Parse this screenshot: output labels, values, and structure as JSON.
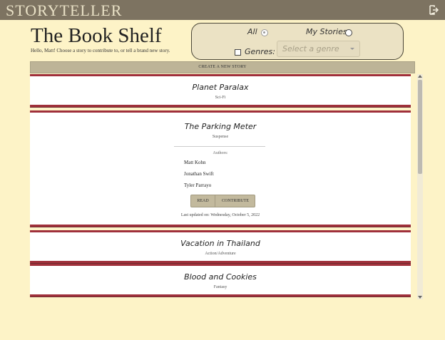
{
  "header": {
    "brand": "STORYTELLER",
    "logout_icon": "logout-icon"
  },
  "page": {
    "title": "The Book Shelf",
    "subtitle": "Hello, Matt! Choose a story to contribute to, or tell a brand new story."
  },
  "filters": {
    "all_label": "All",
    "all_selected": true,
    "my_stories_label": "My Stories",
    "my_stories_selected": false,
    "genres_label": "Genres:",
    "genres_checked": false,
    "genre_placeholder": "Select a genre"
  },
  "create_label": "CREATE A NEW STORY",
  "stories": [
    {
      "title": "Planet Paralax",
      "genre": "Sci-Fi"
    },
    {
      "title": "The Parking Meter",
      "genre": "Suspense",
      "authors_heading": "Authors:",
      "authors": [
        "Matt Kohn",
        "Jonathan Swift",
        "Tyler Parrayo"
      ],
      "read_label": "READ",
      "contribute_label": "CONTRIBUTE",
      "updated": "Last updated on: Wednesday, October 5, 2022"
    },
    {
      "title": "Vacation in Thailand",
      "genre": "Action/Adventure"
    },
    {
      "title": "Blood and Cookies",
      "genre": "Fantasy"
    }
  ],
  "colors": {
    "accent": "#a0303b",
    "topbar": "#7d7361",
    "background": "#fdf3c7"
  }
}
